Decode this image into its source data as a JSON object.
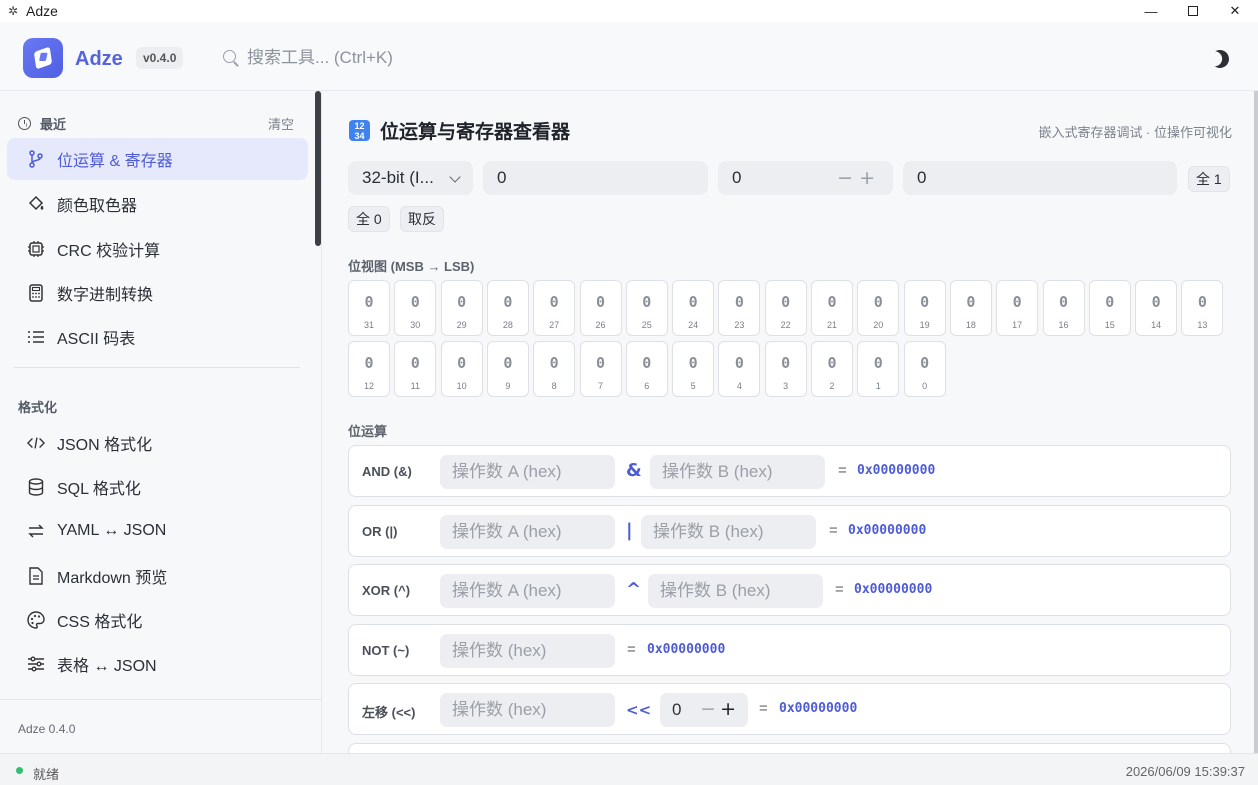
{
  "window": {
    "title": "Adze",
    "icon": "gear-icon"
  },
  "header": {
    "brand": "Adze",
    "version": "v0.4.0",
    "search_placeholder": "搜索工具... (Ctrl+K)"
  },
  "sidebar": {
    "recent_label": "最近",
    "clear_label": "清空",
    "recent_items": [
      {
        "label": "位运算 & 寄存器",
        "icon": "branch-icon",
        "active": true
      },
      {
        "label": "颜色取色器",
        "icon": "paint-bucket-icon"
      },
      {
        "label": "CRC 校验计算",
        "icon": "chip-icon"
      },
      {
        "label": "数字进制转换",
        "icon": "calculator-icon"
      },
      {
        "label": "ASCII 码表",
        "icon": "list-icon"
      }
    ],
    "format_label": "格式化",
    "format_items": [
      {
        "label": "JSON 格式化",
        "icon": "code-icon"
      },
      {
        "label": "SQL 格式化",
        "icon": "database-icon"
      },
      {
        "label": "YAML ↔ JSON",
        "icon": "swap-icon"
      },
      {
        "label": "Markdown 预览",
        "icon": "document-icon"
      },
      {
        "label": "CSS 格式化",
        "icon": "palette-icon"
      },
      {
        "label": "表格 ↔ JSON",
        "icon": "sliders-icon"
      }
    ],
    "footer_version": "Adze 0.4.0"
  },
  "main": {
    "title": "位运算与寄存器查看器",
    "title_icon": "numbers-icon",
    "subtitle": "嵌入式寄存器调试 · 位操作可视化",
    "width_select": "32-bit (I...",
    "hex_value": "0",
    "stepper_value": "0",
    "bin_value": "0",
    "all_one_label": "全 1",
    "all_zero_label": "全 0",
    "invert_label": "取反",
    "bitview_label": "位视图 (MSB → LSB)",
    "bits": [
      {
        "i": "31",
        "v": "0"
      },
      {
        "i": "30",
        "v": "0"
      },
      {
        "i": "29",
        "v": "0"
      },
      {
        "i": "28",
        "v": "0"
      },
      {
        "i": "27",
        "v": "0"
      },
      {
        "i": "26",
        "v": "0"
      },
      {
        "i": "25",
        "v": "0"
      },
      {
        "i": "24",
        "v": "0"
      },
      {
        "i": "23",
        "v": "0"
      },
      {
        "i": "22",
        "v": "0"
      },
      {
        "i": "21",
        "v": "0"
      },
      {
        "i": "20",
        "v": "0"
      },
      {
        "i": "19",
        "v": "0"
      },
      {
        "i": "18",
        "v": "0"
      },
      {
        "i": "17",
        "v": "0"
      },
      {
        "i": "16",
        "v": "0"
      },
      {
        "i": "15",
        "v": "0"
      },
      {
        "i": "14",
        "v": "0"
      },
      {
        "i": "13",
        "v": "0"
      },
      {
        "i": "12",
        "v": "0"
      },
      {
        "i": "11",
        "v": "0"
      },
      {
        "i": "10",
        "v": "0"
      },
      {
        "i": "9",
        "v": "0"
      },
      {
        "i": "8",
        "v": "0"
      },
      {
        "i": "7",
        "v": "0"
      },
      {
        "i": "6",
        "v": "0"
      },
      {
        "i": "5",
        "v": "0"
      },
      {
        "i": "4",
        "v": "0"
      },
      {
        "i": "3",
        "v": "0"
      },
      {
        "i": "2",
        "v": "0"
      },
      {
        "i": "1",
        "v": "0"
      },
      {
        "i": "0",
        "v": "0"
      }
    ],
    "bitops_label": "位运算",
    "ops": {
      "and": {
        "name": "AND (&)",
        "sym": "&",
        "a": "操作数 A (hex)",
        "b": "操作数 B (hex)",
        "eq": "=",
        "result": "0x00000000"
      },
      "or": {
        "name": "OR (|)",
        "sym": "|",
        "a": "操作数 A (hex)",
        "b": "操作数 B (hex)",
        "eq": "=",
        "result": "0x00000000"
      },
      "xor": {
        "name": "XOR (^)",
        "sym": "^",
        "a": "操作数 A (hex)",
        "b": "操作数 B (hex)",
        "eq": "=",
        "result": "0x00000000"
      },
      "not": {
        "name": "NOT (~)",
        "a": "操作数 (hex)",
        "eq": "=",
        "result": "0x00000000"
      },
      "shl": {
        "name": "左移 (<<)",
        "sym": "<<",
        "a": "操作数 (hex)",
        "amount": "0",
        "eq": "=",
        "result": "0x00000000"
      }
    }
  },
  "status": {
    "text": "就绪",
    "timestamp": "2026/06/09 15:39:37",
    "dot_color": "#2fbf71"
  },
  "colors": {
    "accent": "#4e5bd6",
    "active_bg": "#e6e8fb"
  }
}
